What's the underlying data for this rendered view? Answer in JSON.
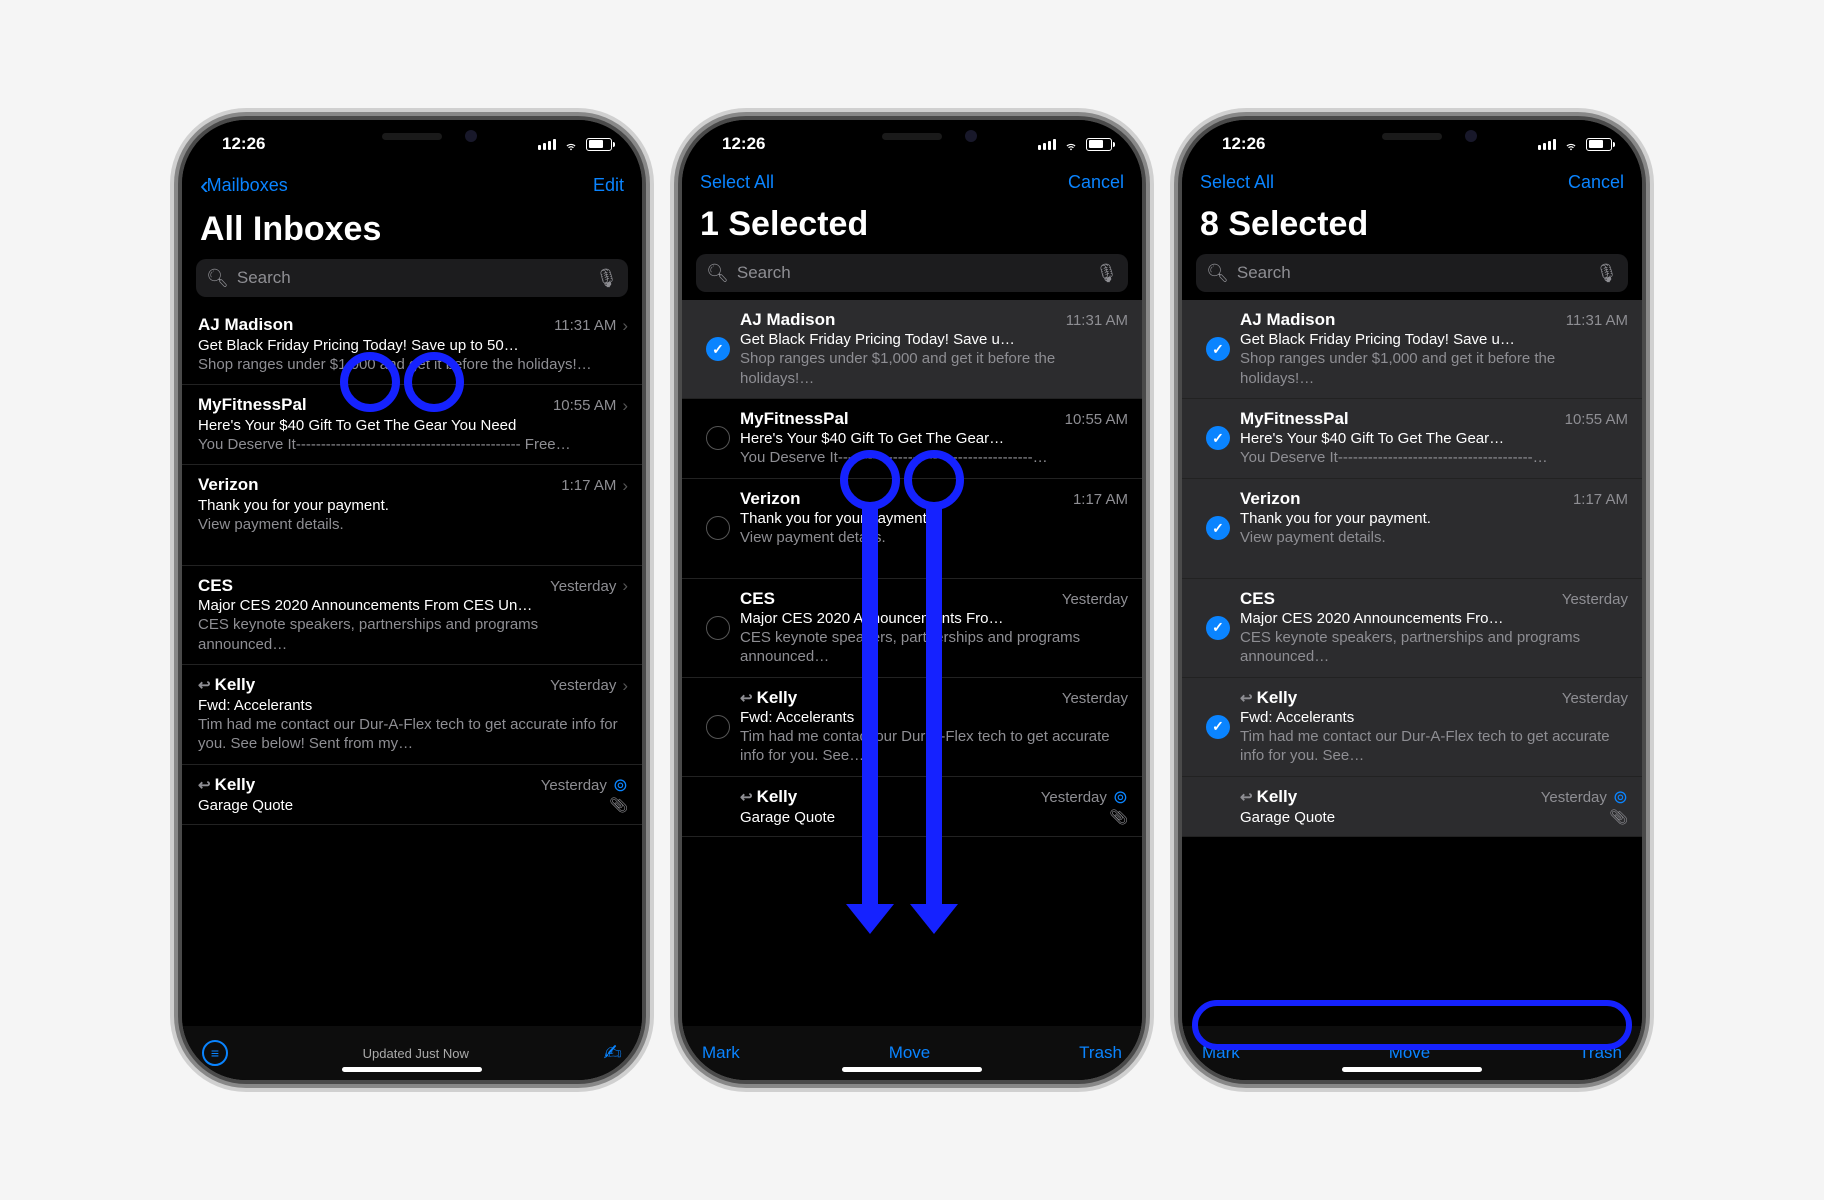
{
  "status": {
    "time": "12:26"
  },
  "colors": {
    "accent": "#0a84ff"
  },
  "search": {
    "placeholder": "Search"
  },
  "phone1": {
    "nav_back": "Mailboxes",
    "nav_right": "Edit",
    "title": "All Inboxes",
    "toolbar_status": "Updated Just Now"
  },
  "phone2": {
    "nav_left": "Select All",
    "nav_right": "Cancel",
    "title": "1 Selected",
    "toolbar": {
      "mark": "Mark",
      "move": "Move",
      "trash": "Trash"
    }
  },
  "phone3": {
    "nav_left": "Select All",
    "nav_right": "Cancel",
    "title": "8 Selected",
    "toolbar": {
      "mark": "Mark",
      "move": "Move",
      "trash": "Trash"
    }
  },
  "emails": [
    {
      "sender": "AJ Madison",
      "time": "11:31 AM",
      "subject": "Get Black Friday Pricing Today! Save up to 50…",
      "subject_s": "Get Black Friday Pricing Today! Save u…",
      "preview": "Shop ranges under $1,000 and get it before the holidays!…"
    },
    {
      "sender": "MyFitnessPal",
      "time": "10:55 AM",
      "subject": "Here's Your $40 Gift To Get The Gear You Need",
      "subject_s": "Here's Your $40 Gift To Get The Gear…",
      "preview": "You Deserve It--------------------------------------------- Free…",
      "preview_s": "You Deserve It---------------------------------------…"
    },
    {
      "sender": "Verizon",
      "time": "1:17 AM",
      "subject": "Thank you for your payment.",
      "preview": "View payment details."
    },
    {
      "sender": "CES",
      "time": "Yesterday",
      "subject": "Major CES 2020 Announcements From CES Un…",
      "subject_s": "Major CES 2020 Announcements Fro…",
      "preview": "CES keynote speakers, partnerships and programs announced…"
    },
    {
      "sender": "Kelly",
      "time": "Yesterday",
      "reply": true,
      "subject": "Fwd: Accelerants",
      "preview": "Tim had me contact our Dur-A-Flex tech to get accurate info for you. See below! Sent from my…",
      "preview_s": "Tim had me contact our Dur-A-Flex tech to get accurate info for you. See…"
    },
    {
      "sender": "Kelly",
      "time": "Yesterday",
      "reply": true,
      "thread": true,
      "attach": true,
      "subject": "Garage Quote",
      "preview": ""
    }
  ]
}
